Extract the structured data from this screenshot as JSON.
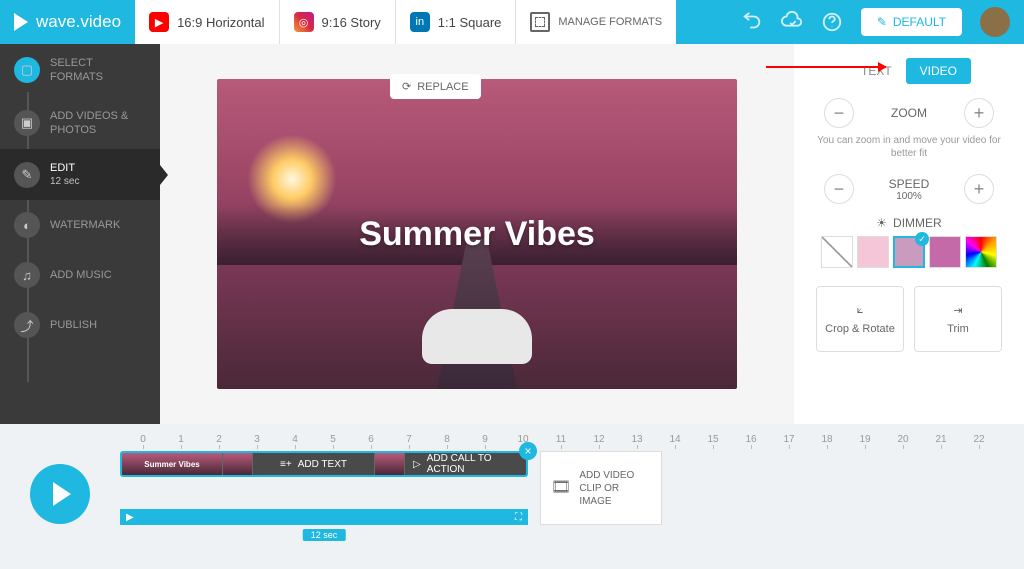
{
  "logo": "wave.video",
  "formats": [
    {
      "icon": "yt",
      "glyph": "▶",
      "label": "16:9 Horizontal"
    },
    {
      "icon": "ig",
      "glyph": "◎",
      "label": "9:16 Story"
    },
    {
      "icon": "li",
      "glyph": "in",
      "label": "1:1 Square"
    }
  ],
  "manage_formats": "MANAGE FORMATS",
  "default_btn": "DEFAULT",
  "sidebar": [
    {
      "label": "SELECT FORMATS",
      "sub": ""
    },
    {
      "label": "ADD VIDEOS & PHOTOS",
      "sub": ""
    },
    {
      "label": "EDIT",
      "sub": "12 sec"
    },
    {
      "label": "WATERMARK",
      "sub": ""
    },
    {
      "label": "ADD MUSIC",
      "sub": ""
    },
    {
      "label": "PUBLISH",
      "sub": ""
    }
  ],
  "canvas": {
    "title": "Summer Vibes",
    "replace": "REPLACE"
  },
  "right": {
    "tabs": [
      "TEXT",
      "VIDEO"
    ],
    "zoom_label": "ZOOM",
    "zoom_hint": "You can zoom in and move your video for better fit",
    "speed_label": "SPEED",
    "speed_value": "100%",
    "dimmer_label": "DIMMER",
    "swatches": [
      "transparent",
      "#f4c6d8",
      "#c99bbf",
      "#c56aa8",
      "rainbow"
    ],
    "crop_rotate": "Crop & Rotate",
    "trim": "Trim"
  },
  "timeline": {
    "ticks": [
      "0",
      "1",
      "2",
      "3",
      "4",
      "5",
      "6",
      "7",
      "8",
      "9",
      "10",
      "11",
      "12",
      "13",
      "14",
      "15",
      "16",
      "17",
      "18",
      "19",
      "20",
      "21",
      "22"
    ],
    "clip_thumb_text": "Summer Vibes",
    "add_text": "ADD TEXT",
    "add_cta": "ADD CALL TO ACTION",
    "add_clip": "ADD VIDEO CLIP OR IMAGE",
    "duration": "12 sec"
  }
}
